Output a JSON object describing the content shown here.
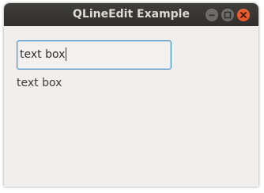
{
  "window": {
    "title": "QLineEdit Example",
    "controls": {
      "minimize_icon": "minimize-icon",
      "maximize_icon": "maximize-icon",
      "close_icon": "close-icon",
      "close_color": "#e95a2a"
    }
  },
  "line_edit": {
    "value": "text box",
    "focus_color": "#4a90c8"
  },
  "label": {
    "text": "text box"
  }
}
